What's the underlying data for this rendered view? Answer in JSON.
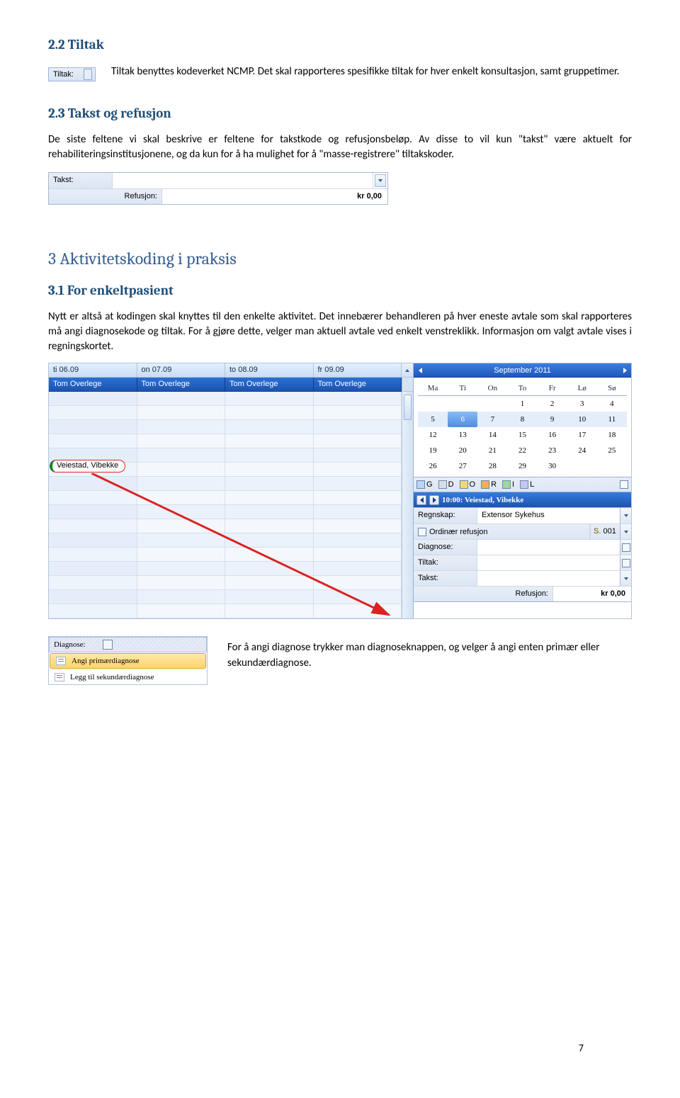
{
  "sections": {
    "s22_title": "2.2  Tiltak",
    "s22_para": "Tiltak benyttes kodeverket NCMP. Det skal rapporteres spesifikke tiltak for hver enkelt konsultasjon, samt gruppetimer.",
    "s23_title": "2.3  Takst og refusjon",
    "s23_para": "De siste feltene vi skal beskrive er feltene for takstkode og refusjonsbeløp. Av disse to vil kun \"takst\" være aktuelt for rehabiliteringsinstitusjonene, og da kun for å ha mulighet for å \"masse-registrere\" tiltakskoder.",
    "s3_title": "3   Aktivitetskoding i praksis",
    "s31_title": "3.1  For enkeltpasient",
    "s31_para": "Nytt er altså at kodingen skal knyttes til den enkelte aktivitet. Det innebærer behandleren på hver eneste avtale som skal rapporteres må angi diagnosekode og tiltak. For å gjøre dette, velger man aktuell avtale ved enkelt venstreklikk. Informasjon om valgt avtale vises i regningskortet."
  },
  "tiltak_field": {
    "label": "Tiltak:"
  },
  "takst_box": {
    "takst_label": "Takst:",
    "refusjon_label": "Refusjon:",
    "refusjon_value": "kr 0,00"
  },
  "calendar": {
    "days": [
      "ti 06.09",
      "on 07.09",
      "to 08.09",
      "fr 09.09"
    ],
    "person": "Tom Overlege",
    "appointment_name": "Veiestad, Vibekke",
    "month_title": "September 2011",
    "weekdays": [
      "Ma",
      "Ti",
      "On",
      "To",
      "Fr",
      "Lø",
      "Sø"
    ],
    "weeks": [
      [
        "",
        "",
        "",
        "1",
        "2",
        "3",
        "4"
      ],
      [
        "5",
        "6",
        "7",
        "8",
        "9",
        "10",
        "11"
      ],
      [
        "12",
        "13",
        "14",
        "15",
        "16",
        "17",
        "18"
      ],
      [
        "19",
        "20",
        "21",
        "22",
        "23",
        "24",
        "25"
      ],
      [
        "26",
        "27",
        "28",
        "29",
        "30",
        "",
        ""
      ]
    ],
    "selected_day": "6",
    "type_labels": [
      "G",
      "D",
      "O",
      "R",
      "I",
      "L"
    ],
    "appt_nav_text": "10:00: Veiestad, Vibekke",
    "form": {
      "regnskap_label": "Regnskap:",
      "regnskap_value": "Extensor Sykehus",
      "ordinar_label": "Ordinær refusjon",
      "side_label": "001",
      "side_prefix": "S.",
      "diagnose_label": "Diagnose:",
      "tiltak_label": "Tiltak:",
      "takst_label": "Takst:",
      "refusjon_label": "Refusjon:",
      "refusjon_value": "kr 0,00"
    }
  },
  "diag_box": {
    "head": "Diagnose:",
    "item1": "Angi primærdiagnose",
    "item2": "Legg til sekundærdiagnose"
  },
  "bottom_text": "For å angi diagnose trykker man diagnoseknappen, og velger å angi enten primær eller sekundærdiagnose.",
  "page_number": "7"
}
